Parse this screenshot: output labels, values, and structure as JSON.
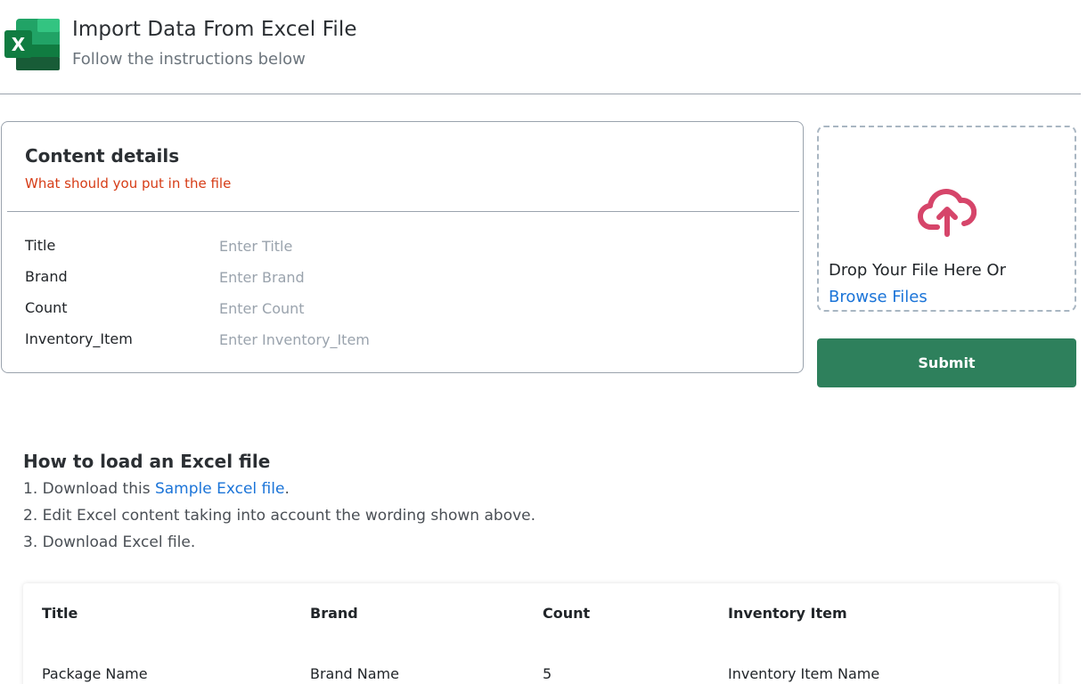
{
  "header": {
    "title": "Import Data From Excel File",
    "subtitle": "Follow the instructions below",
    "logo_letter": "X",
    "logo_icon": "excel-logo-icon"
  },
  "content_card": {
    "title": "Content details",
    "subtitle": "What should you put in the file",
    "fields": [
      {
        "label": "Title",
        "placeholder": "Enter Title",
        "value": ""
      },
      {
        "label": "Brand",
        "placeholder": "Enter Brand",
        "value": ""
      },
      {
        "label": "Count",
        "placeholder": "Enter Count",
        "value": ""
      },
      {
        "label": "Inventory_Item",
        "placeholder": "Enter Inventory_Item",
        "value": ""
      }
    ]
  },
  "dropzone": {
    "icon": "cloud-upload-icon",
    "text": "Drop Your File Here Or",
    "browse_label": "Browse Files"
  },
  "submit_label": "Submit",
  "howto": {
    "title": "How to load an Excel file",
    "step1_prefix": "1. Download this ",
    "step1_link": "Sample Excel file",
    "step1_suffix": ".",
    "step2": "2. Edit Excel content taking into account the wording shown above.",
    "step3": "3. Download Excel file."
  },
  "sample_table": {
    "headers": [
      "Title",
      "Brand",
      "Count",
      "Inventory Item"
    ],
    "rows": [
      [
        "Package Name",
        "Brand Name",
        "5",
        "Inventory Item Name"
      ]
    ]
  },
  "colors": {
    "accent_green": "#2e805c",
    "link_blue": "#1b74d8",
    "warning_red": "#d63c16",
    "upload_icon_pink": "#d6456a"
  }
}
